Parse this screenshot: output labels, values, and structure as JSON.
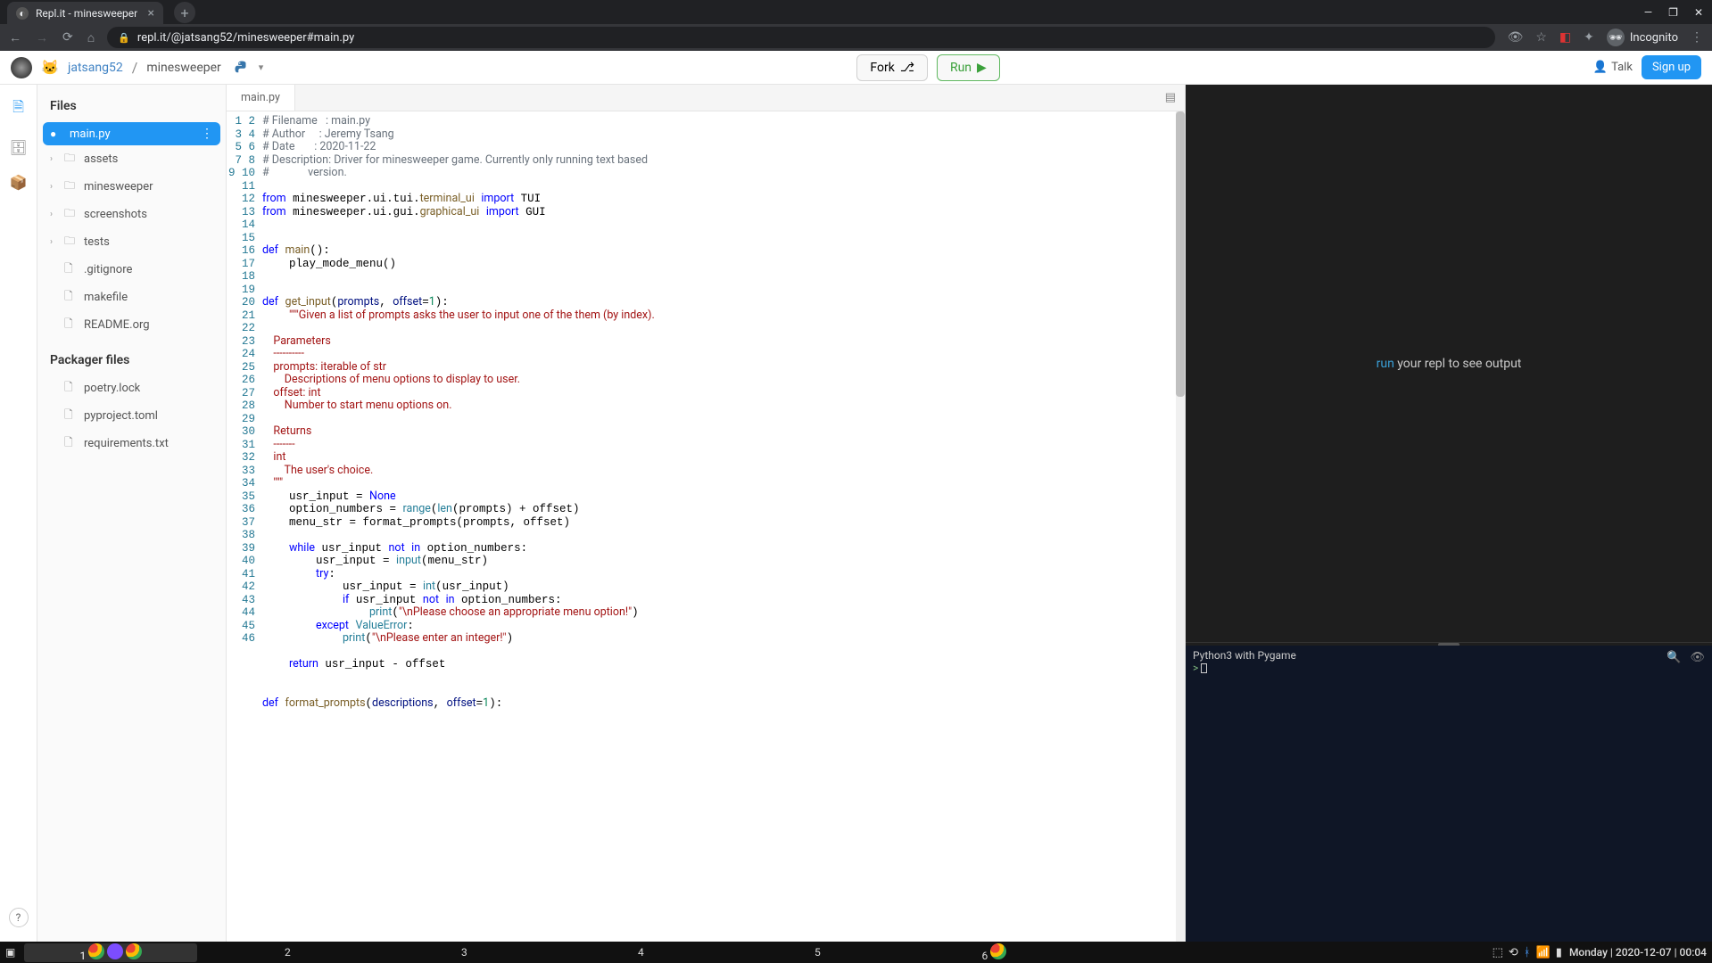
{
  "browser": {
    "tab_title": "Repl.it - minesweeper",
    "url": "repl.it/@jatsang52/minesweeper#main.py",
    "incognito_label": "Incognito"
  },
  "header": {
    "user": "jatsang52",
    "repo": "minesweeper",
    "fork_label": "Fork",
    "run_label": "Run",
    "talk_label": "Talk",
    "signup_label": "Sign up"
  },
  "sidebar": {
    "files_title": "Files",
    "selected": "main.py",
    "folders": [
      "assets",
      "minesweeper",
      "screenshots",
      "tests"
    ],
    "files": [
      ".gitignore",
      "makefile",
      "README.org"
    ],
    "packager_title": "Packager files",
    "packager_files": [
      "poetry.lock",
      "pyproject.toml",
      "requirements.txt"
    ]
  },
  "editor": {
    "tab": "main.py",
    "line_start": 1,
    "line_end": 46
  },
  "output": {
    "run_word": "run",
    "rest": " your repl to see output"
  },
  "terminal": {
    "header": "Python3 with Pygame",
    "prompt": ">"
  },
  "taskbar": {
    "workspaces": [
      "1",
      "2",
      "3",
      "4",
      "5",
      "6"
    ],
    "clock": "Monday | 2020-12-07 | 00:04"
  },
  "code": [
    {
      "t": "comment",
      "s": "# Filename   : main.py"
    },
    {
      "t": "comment",
      "s": "# Author     : Jeremy Tsang"
    },
    {
      "t": "comment",
      "s": "# Date       : 2020-11-22"
    },
    {
      "t": "comment",
      "s": "# Description: Driver for minesweeper game. Currently only running text based"
    },
    {
      "t": "comment",
      "s": "#              version."
    },
    {
      "t": "blank",
      "s": ""
    },
    {
      "t": "raw",
      "s": "<span class=\"c-kw\">from</span> minesweeper.ui.tui.<span class=\"c-fn\">terminal_ui</span> <span class=\"c-kw\">import</span> TUI"
    },
    {
      "t": "raw",
      "s": "<span class=\"c-kw\">from</span> minesweeper.ui.gui.<span class=\"c-fn\">graphical_ui</span> <span class=\"c-kw\">import</span> GUI"
    },
    {
      "t": "blank",
      "s": ""
    },
    {
      "t": "blank",
      "s": ""
    },
    {
      "t": "raw",
      "s": "<span class=\"c-kw\">def</span> <span class=\"c-fn\">main</span>():"
    },
    {
      "t": "raw",
      "s": "    play_mode_menu()"
    },
    {
      "t": "blank",
      "s": ""
    },
    {
      "t": "blank",
      "s": ""
    },
    {
      "t": "raw",
      "s": "<span class=\"c-kw\">def</span> <span class=\"c-fn\">get_input</span>(<span class=\"c-param\">prompts</span>, <span class=\"c-param\">offset</span>=<span class=\"c-num\">1</span>):"
    },
    {
      "t": "raw",
      "s": "    <span class=\"c-str\">\"\"\"Given a list of prompts asks the user to input one of the them (by index).</span>"
    },
    {
      "t": "str",
      "s": ""
    },
    {
      "t": "str",
      "s": "    Parameters"
    },
    {
      "t": "str",
      "s": "    ----------"
    },
    {
      "t": "str",
      "s": "    prompts: iterable of str"
    },
    {
      "t": "str",
      "s": "        Descriptions of menu options to display to user."
    },
    {
      "t": "str",
      "s": "    offset: int"
    },
    {
      "t": "str",
      "s": "        Number to start menu options on."
    },
    {
      "t": "str",
      "s": ""
    },
    {
      "t": "str",
      "s": "    Returns"
    },
    {
      "t": "str",
      "s": "    -------"
    },
    {
      "t": "str",
      "s": "    int"
    },
    {
      "t": "str",
      "s": "        The user's choice."
    },
    {
      "t": "str",
      "s": "    \"\"\""
    },
    {
      "t": "raw",
      "s": "    usr_input = <span class=\"c-kw\">None</span>"
    },
    {
      "t": "raw",
      "s": "    option_numbers = <span class=\"c-builtin\">range</span>(<span class=\"c-builtin\">len</span>(prompts) + offset)"
    },
    {
      "t": "raw",
      "s": "    menu_str = format_prompts(prompts, offset)"
    },
    {
      "t": "blank",
      "s": ""
    },
    {
      "t": "raw",
      "s": "    <span class=\"c-kw\">while</span> usr_input <span class=\"c-kw\">not</span> <span class=\"c-kw\">in</span> option_numbers:"
    },
    {
      "t": "raw",
      "s": "        usr_input = <span class=\"c-builtin\">input</span>(menu_str)"
    },
    {
      "t": "raw",
      "s": "        <span class=\"c-kw\">try</span>:"
    },
    {
      "t": "raw",
      "s": "            usr_input = <span class=\"c-builtin\">int</span>(usr_input)"
    },
    {
      "t": "raw",
      "s": "            <span class=\"c-kw\">if</span> usr_input <span class=\"c-kw\">not</span> <span class=\"c-kw\">in</span> option_numbers:"
    },
    {
      "t": "raw",
      "s": "                <span class=\"c-builtin\">print</span>(<span class=\"c-str\">\"\\nPlease choose an appropriate menu option!\"</span>)"
    },
    {
      "t": "raw",
      "s": "        <span class=\"c-kw\">except</span> <span class=\"c-builtin\">ValueError</span>:"
    },
    {
      "t": "raw",
      "s": "            <span class=\"c-builtin\">print</span>(<span class=\"c-str\">\"\\nPlease enter an integer!\"</span>)"
    },
    {
      "t": "blank",
      "s": ""
    },
    {
      "t": "raw",
      "s": "    <span class=\"c-kw\">return</span> usr_input - offset"
    },
    {
      "t": "blank",
      "s": ""
    },
    {
      "t": "blank",
      "s": ""
    },
    {
      "t": "raw",
      "s": "<span class=\"c-kw\">def</span> <span class=\"c-fn\">format_prompts</span>(<span class=\"c-param\">descriptions</span>, <span class=\"c-param\">offset</span>=<span class=\"c-num\">1</span>):"
    }
  ]
}
